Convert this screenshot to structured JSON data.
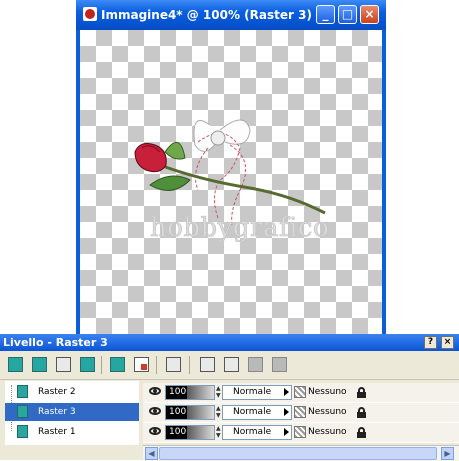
{
  "image_window": {
    "title": "Immagine4* @ 100% (Raster 3)",
    "buttons": {
      "minimize": "_",
      "maximize": "□",
      "close": "×"
    },
    "watermark": "hobbygrafico"
  },
  "layer_palette": {
    "title": "Livello - Raster 3",
    "buttons": {
      "help": "?",
      "close": "×"
    },
    "layers": [
      {
        "name": "Raster 2",
        "opacity": "100",
        "blend_mode": "Normale",
        "mask": "Nessuno",
        "selected": false
      },
      {
        "name": "Raster 3",
        "opacity": "100",
        "blend_mode": "Normale",
        "mask": "Nessuno",
        "selected": true
      },
      {
        "name": "Raster 1",
        "opacity": "100",
        "blend_mode": "Normale",
        "mask": "Nessuno",
        "selected": false
      }
    ],
    "scroll": {
      "left": "◀",
      "right": "▶"
    }
  },
  "icons": {
    "app": "psp-app-icon",
    "visibility": "eye-icon",
    "lock": "lock-icon"
  },
  "colors": {
    "title_bar": "#0a5fe0",
    "selection": "#316ac5",
    "layer_thumb": "#2aa5a0"
  }
}
